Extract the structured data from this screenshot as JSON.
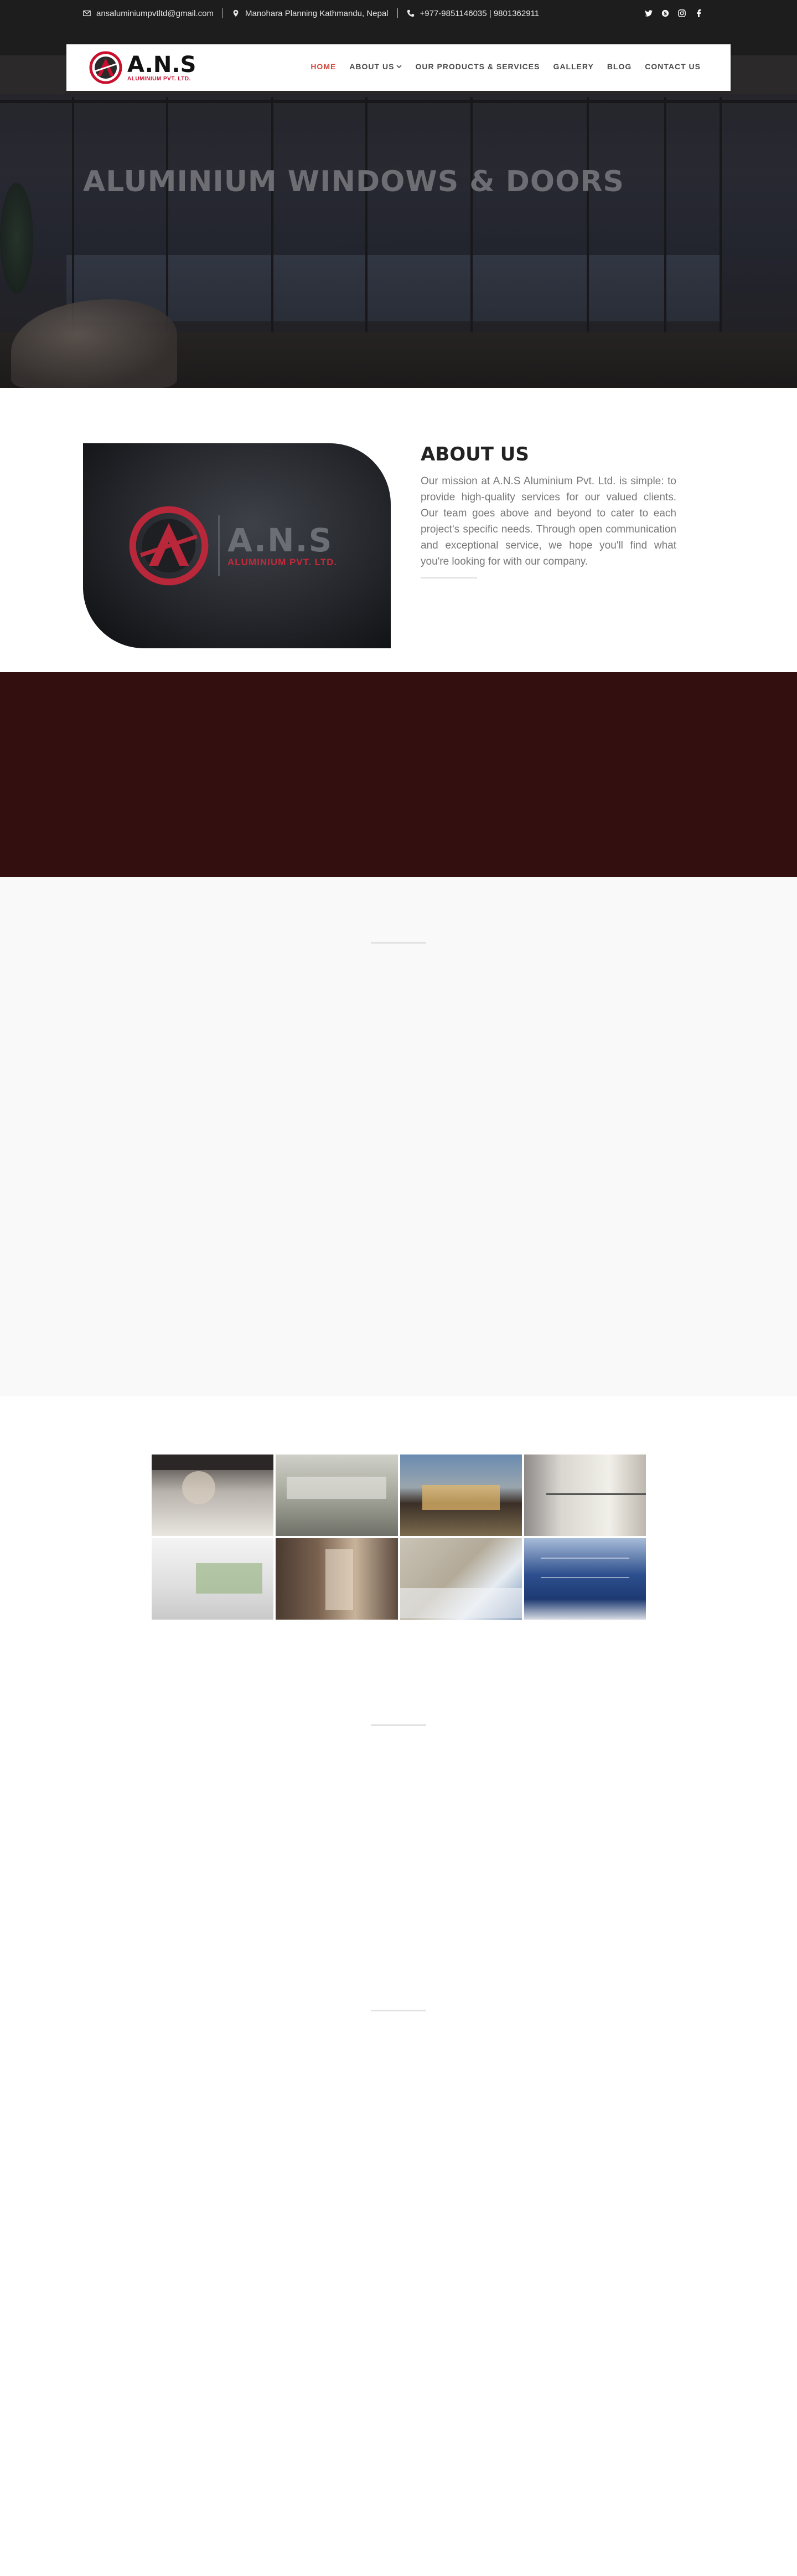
{
  "topbar": {
    "email": "ansaluminiumpvtltd@gmail.com",
    "address": "Manohara Planning Kathmandu, Nepal",
    "phone": "+977-9851146035 | 9801362911",
    "icons": [
      "envelope-icon",
      "map-marker-icon",
      "phone-icon"
    ],
    "socials": [
      "twitter-icon",
      "skype-icon",
      "instagram-icon",
      "facebook-icon"
    ]
  },
  "logo": {
    "main": "A.N.S",
    "sub": "ALUMINIUM PVT. LTD."
  },
  "nav": {
    "items": [
      "HOME",
      "ABOUT US",
      "OUR PRODUCTS & SERVICES",
      "GALLERY",
      "BLOG",
      "CONTACT US"
    ],
    "active": "HOME",
    "active_color": "#d0463a"
  },
  "hero": {
    "title": "ALUMINIUM WINDOWS & DOORS"
  },
  "about": {
    "title": "ABOUT US",
    "body": "Our mission at A.N.S Aluminium Pvt. Ltd. is simple: to provide high-quality services for our valued clients. Our team goes above and beyond to cater to each project's specific needs. Through open communication and exceptional service, we hope you'll find what you're looking for with our company.",
    "image_brand_main": "A.N.S",
    "image_brand_sub": "ALUMINIUM PVT. LTD."
  },
  "colors": {
    "topbar": "#1d1d1d",
    "band_red": "#340f10",
    "band_grey": "#f9f9f9",
    "accent": "#c8102e"
  },
  "gallery": {
    "tiles": [
      "interior-living-room",
      "office-interior",
      "modern-house-exterior",
      "glass-balcony-railing",
      "white-room-windows",
      "brick-wall-interior",
      "aluminium-panel-facade",
      "glass-building-facade"
    ]
  }
}
